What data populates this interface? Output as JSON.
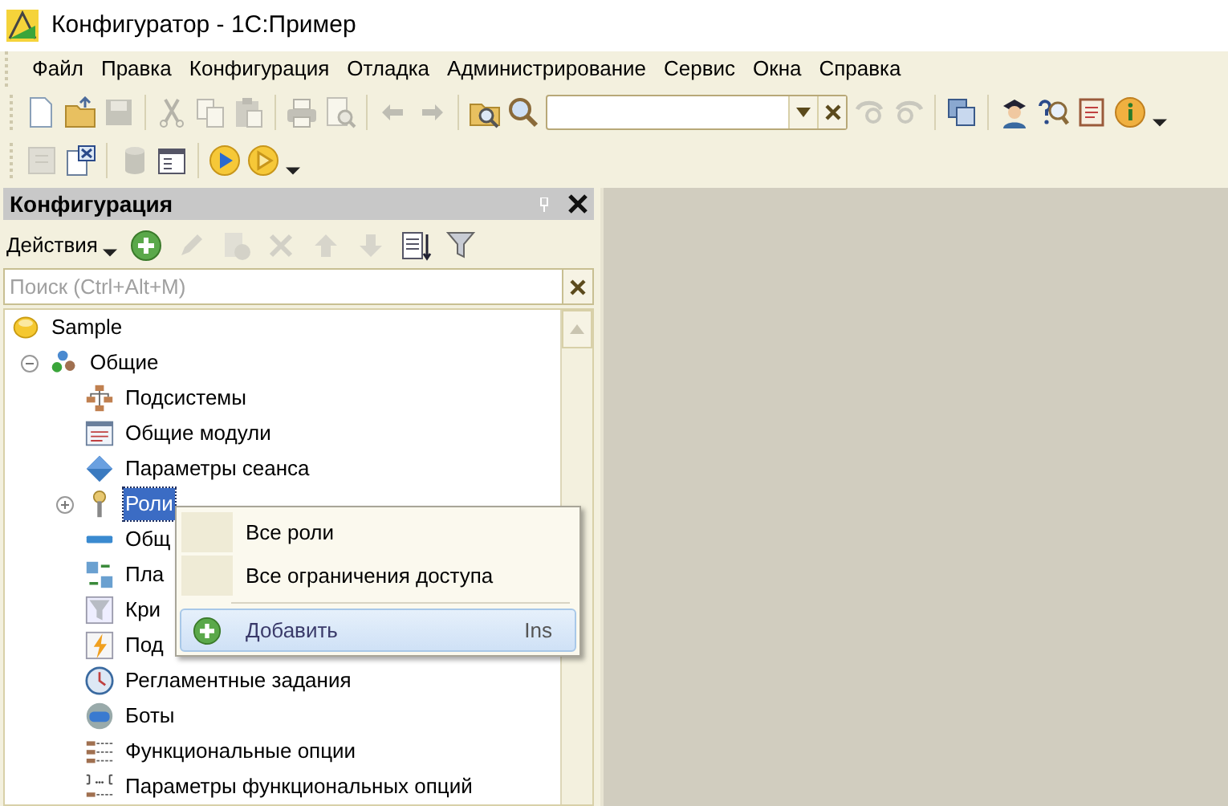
{
  "window": {
    "title": "Конфигуратор - 1С:Пример"
  },
  "menu_bar": [
    {
      "label": "Файл"
    },
    {
      "label": "Правка"
    },
    {
      "label": "Конфигурация"
    },
    {
      "label": "Отладка"
    },
    {
      "label": "Администрирование"
    },
    {
      "label": "Сервис"
    },
    {
      "label": "Окна"
    },
    {
      "label": "Справка"
    }
  ],
  "toolbars": [
    {
      "items": [
        {
          "kind": "new",
          "disabled": false
        },
        {
          "kind": "open",
          "disabled": false
        },
        {
          "kind": "save",
          "disabled": true
        },
        {
          "kind": "separator"
        },
        {
          "kind": "cut",
          "disabled": true
        },
        {
          "kind": "copy",
          "disabled": true
        },
        {
          "kind": "paste",
          "disabled": true
        },
        {
          "kind": "separator"
        },
        {
          "kind": "print",
          "disabled": true
        },
        {
          "kind": "preview",
          "disabled": true
        },
        {
          "kind": "separator"
        },
        {
          "kind": "undo",
          "disabled": true
        },
        {
          "kind": "redo",
          "disabled": true
        },
        {
          "kind": "separator"
        },
        {
          "kind": "find-folder",
          "disabled": false
        },
        {
          "kind": "search",
          "disabled": false
        },
        {
          "kind": "search-combo",
          "disabled": false
        },
        {
          "kind": "find-next",
          "disabled": true
        },
        {
          "kind": "find-prev",
          "disabled": true
        },
        {
          "kind": "separator"
        },
        {
          "kind": "windows",
          "disabled": false
        },
        {
          "kind": "separator"
        },
        {
          "kind": "tutor",
          "disabled": false
        },
        {
          "kind": "help-search",
          "disabled": false
        },
        {
          "kind": "book",
          "disabled": false
        },
        {
          "kind": "info",
          "disabled": false
        },
        {
          "kind": "caret",
          "disabled": false
        }
      ]
    },
    {
      "items": [
        {
          "kind": "module",
          "disabled": true
        },
        {
          "kind": "compare",
          "disabled": false
        },
        {
          "kind": "separator"
        },
        {
          "kind": "database",
          "disabled": true
        },
        {
          "kind": "window-list",
          "disabled": false
        },
        {
          "kind": "separator"
        },
        {
          "kind": "run",
          "disabled": false
        },
        {
          "kind": "debug-run",
          "disabled": false
        },
        {
          "kind": "caret",
          "disabled": false
        }
      ]
    }
  ],
  "panel": {
    "title": "Конфигурация",
    "actions": {
      "label": "Действия",
      "items": [
        {
          "kind": "add",
          "disabled": false
        },
        {
          "kind": "edit",
          "disabled": true
        },
        {
          "kind": "copy-add",
          "disabled": true
        },
        {
          "kind": "delete",
          "disabled": true
        },
        {
          "kind": "up",
          "disabled": true
        },
        {
          "kind": "down",
          "disabled": true
        },
        {
          "kind": "sort",
          "disabled": false
        },
        {
          "kind": "filter",
          "disabled": false
        }
      ]
    },
    "search": {
      "placeholder": "Поиск (Ctrl+Alt+M)"
    },
    "tree": [
      {
        "label": "Sample",
        "kind": "root",
        "selected": false,
        "children": [
          {
            "label": "Общие",
            "kind": "common",
            "expanded": true,
            "selected": false,
            "children": [
              {
                "label": "Подсистемы",
                "kind": "subsystems",
                "selected": false
              },
              {
                "label": "Общие модули",
                "kind": "modules",
                "selected": false
              },
              {
                "label": "Параметры сеанса",
                "kind": "session",
                "selected": false
              },
              {
                "label": "Роли",
                "kind": "roles",
                "expanded": false,
                "selected": true
              },
              {
                "label": "Общ",
                "kind": "attribute",
                "selected": false
              },
              {
                "label": "Пла",
                "kind": "exchange",
                "selected": false
              },
              {
                "label": "Кри",
                "kind": "criteria",
                "selected": false
              },
              {
                "label": "Под",
                "kind": "subscription",
                "selected": false
              },
              {
                "label": "Регламентные задания",
                "kind": "jobs",
                "selected": false
              },
              {
                "label": "Боты",
                "kind": "bots",
                "selected": false
              },
              {
                "label": "Функциональные опции",
                "kind": "options",
                "selected": false
              },
              {
                "label": "Параметры функциональных опций",
                "kind": "option-params",
                "selected": false
              }
            ]
          }
        ]
      }
    ]
  },
  "context_menu": [
    {
      "kind": "item",
      "label": "Все роли",
      "selected": false
    },
    {
      "kind": "item",
      "label": "Все ограничения доступа",
      "selected": false
    },
    {
      "kind": "separator"
    },
    {
      "kind": "add",
      "label": "Добавить",
      "shortcut": "Ins",
      "selected": true
    }
  ]
}
